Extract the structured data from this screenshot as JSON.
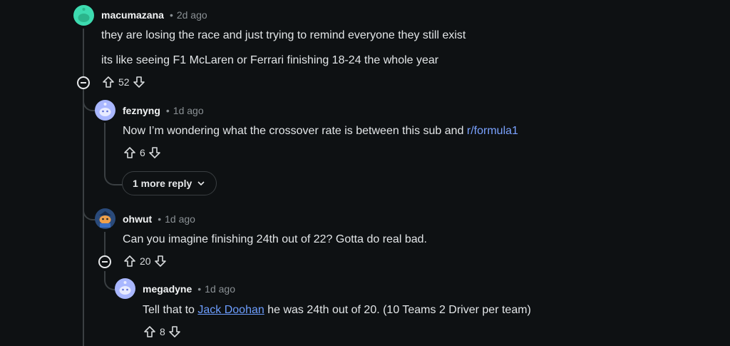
{
  "comments": [
    {
      "username": "macumazana",
      "time": "2d ago",
      "lines": [
        "they are losing the race and just trying to remind everyone they still exist",
        "its like seeing F1 McLaren or Ferrari finishing 18-24 the whole year"
      ],
      "votes": "52"
    },
    {
      "username": "feznyng",
      "time": "1d ago",
      "text_before": "Now I’m wondering what the crossover rate is between this sub and ",
      "link": "r/formula1",
      "votes": "6"
    },
    {
      "username": "ohwut",
      "time": "1d ago",
      "text": "Can you imagine finishing 24th out of 22? Gotta do real bad.",
      "votes": "20"
    },
    {
      "username": "megadyne",
      "time": "1d ago",
      "text_before": "Tell that to ",
      "link": "Jack Doohan",
      "text_after": " he was 24th out of 20. (10 Teams 2 Driver per team)",
      "votes": "8"
    }
  ],
  "more_replies_label": "1 more reply",
  "colors": {
    "background": "#0e1113",
    "link": "#7aa2ff",
    "thread_line": "#3a3f42"
  }
}
